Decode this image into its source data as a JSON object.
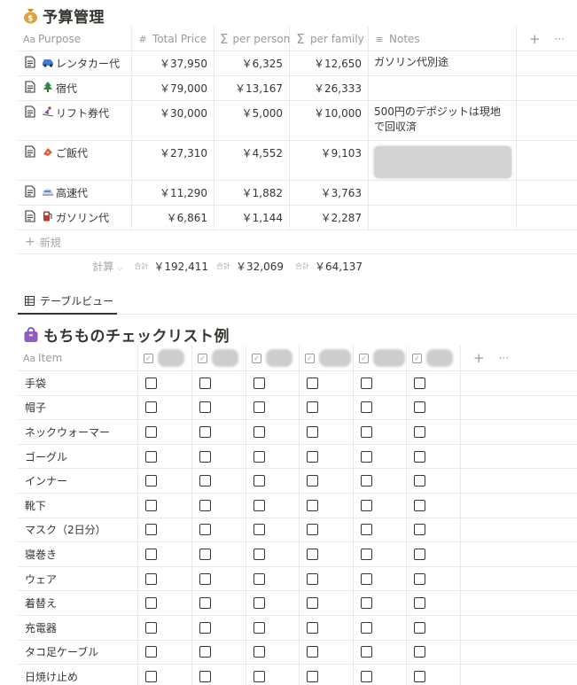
{
  "budget": {
    "title": "予算管理",
    "title_icon": "money-bag-icon",
    "columns": [
      {
        "label": "Purpose",
        "icon": "Aa"
      },
      {
        "label": "Total Price",
        "icon": "#"
      },
      {
        "label": "per person",
        "icon": "Σ"
      },
      {
        "label": "per family",
        "icon": "Σ"
      },
      {
        "label": "Notes",
        "icon": "≡"
      }
    ],
    "add_column": "+",
    "more": "···",
    "rows": [
      {
        "purpose": "レンタカー代",
        "emoji": "car-icon",
        "total": "￥37,950",
        "per_person": "￥6,325",
        "per_family": "￥12,650",
        "notes": "ガソリン代別途"
      },
      {
        "purpose": "宿代",
        "emoji": "evergreen-tree-icon",
        "total": "￥79,000",
        "per_person": "￥13,167",
        "per_family": "￥26,333",
        "notes": ""
      },
      {
        "purpose": "リフト券代",
        "emoji": "skier-icon",
        "total": "￥30,000",
        "per_person": "￥5,000",
        "per_family": "￥10,000",
        "notes": "500円のデポジットは現地で回収済"
      },
      {
        "purpose": "ご飯代",
        "emoji": "fish-cake-icon",
        "total": "￥27,310",
        "per_person": "￥4,552",
        "per_family": "￥9,103",
        "notes": ""
      },
      {
        "purpose": "高速代",
        "emoji": "bullet-train-icon",
        "total": "￥11,290",
        "per_person": "￥1,882",
        "per_family": "￥3,763",
        "notes": ""
      },
      {
        "purpose": "ガソリン代",
        "emoji": "fuel-pump-icon",
        "total": "￥6,861",
        "per_person": "￥1,144",
        "per_family": "￥2,287",
        "notes": ""
      }
    ],
    "new_label": "新規",
    "calc_label": "計算",
    "sum_prefix": "合計",
    "totals": {
      "total": "￥192,411",
      "per_person": "￥32,069",
      "per_family": "￥64,137"
    }
  },
  "view_tab": {
    "label": "テーブルビュー",
    "icon": "table-icon"
  },
  "checklist": {
    "title": "もちものチェックリスト例",
    "title_icon": "handbag-icon",
    "item_header": "Item",
    "item_header_icon": "Aa",
    "member_columns": 6,
    "add_column": "+",
    "more": "···",
    "items": [
      "手袋",
      "帽子",
      "ネックウォーマー",
      "ゴーグル",
      "インナー",
      "靴下",
      "マスク（2日分）",
      "寝巻き",
      "ウェア",
      "着替え",
      "充電器",
      "タコ足ケーブル",
      "日焼け止め"
    ]
  },
  "colors": {
    "text": "#37352f",
    "muted": "#9b9a97",
    "border": "#e9e9e7"
  }
}
